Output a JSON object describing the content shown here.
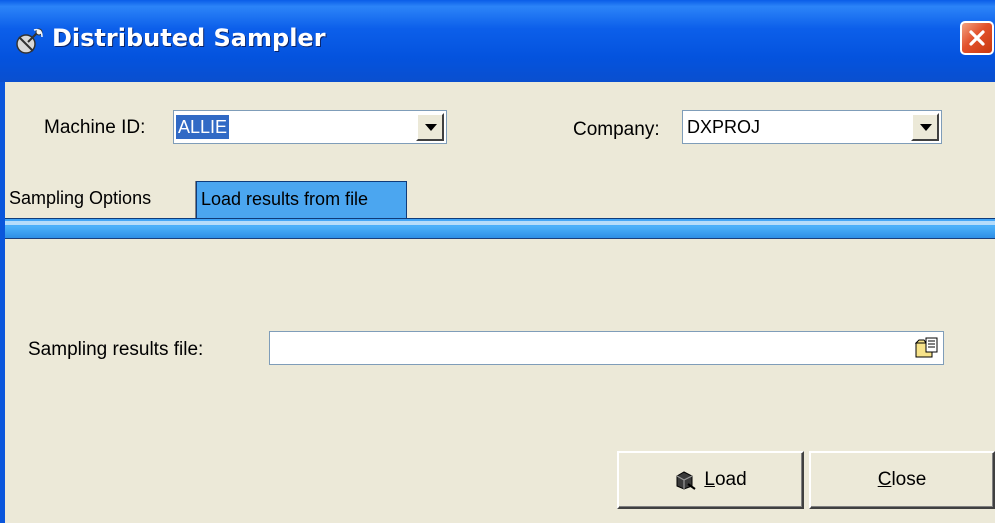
{
  "window": {
    "title": "Distributed Sampler",
    "title_icon": "satellite-icon",
    "close_icon": "close-icon"
  },
  "fields": {
    "machine_id": {
      "label": "Machine ID:",
      "value": "ALLIE"
    },
    "company": {
      "label": "Company:",
      "value": "DXPROJ"
    }
  },
  "tabs": [
    {
      "label": "Sampling Options",
      "active": false
    },
    {
      "label": "Load results from file",
      "active": true
    }
  ],
  "load_page": {
    "file_label": "Sampling results file:",
    "file_value": "",
    "browse_icon": "open-folder-icon"
  },
  "buttons": {
    "load": {
      "accel": "L",
      "rest": "oad",
      "icon": "load-icon"
    },
    "close": {
      "accel": "C",
      "rest": "lose"
    }
  },
  "colors": {
    "titlebar": "#0A5DE8",
    "face": "#ECE9D8",
    "active_tab": "#4BA6F0",
    "selection": "#316AC5",
    "close_button": "#E2512B"
  }
}
